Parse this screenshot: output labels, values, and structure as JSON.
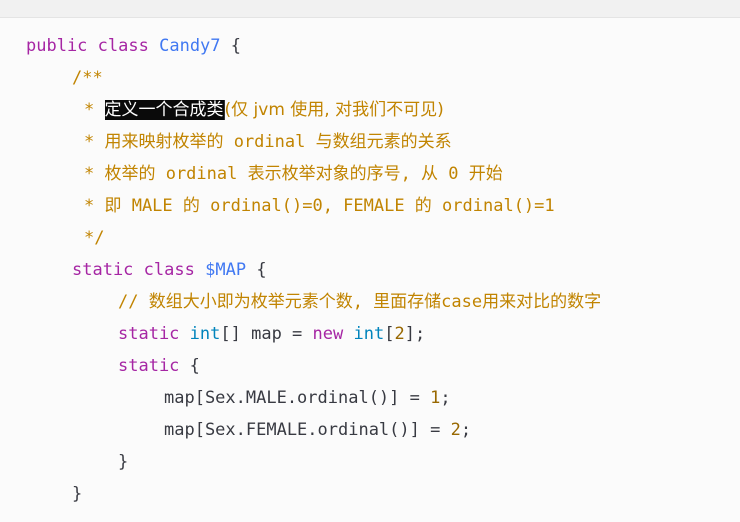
{
  "code": {
    "line1": {
      "kw1": "public",
      "kw2": "class",
      "name": "Candy7",
      "brace": "{"
    },
    "line2": {
      "text": "/**"
    },
    "line3": {
      "star": "*",
      "selected": "定义一个合成类",
      "rest": "(仅 jvm 使用, 对我们不可见)"
    },
    "line4": {
      "text": "* 用来映射枚举的 ordinal 与数组元素的关系"
    },
    "line5": {
      "text": "* 枚举的 ordinal 表示枚举对象的序号, 从 0 开始"
    },
    "line6": {
      "text": "* 即 MALE 的 ordinal()=0, FEMALE 的 ordinal()=1"
    },
    "line7": {
      "text": "*/"
    },
    "line8": {
      "kw1": "static",
      "kw2": "class",
      "name": "$MAP",
      "brace": "{"
    },
    "line9": {
      "text": "// 数组大小即为枚举元素个数, 里面存储case用来对比的数字"
    },
    "line10": {
      "kw1": "static",
      "type1": "int",
      "mid": "[] map = ",
      "kw2": "new",
      "type2": "int",
      "open": "[",
      "num": "2",
      "close": "];"
    },
    "line11": {
      "kw": "static",
      "brace": "{"
    },
    "line12": {
      "expr": "map[Sex.MALE.ordinal()] = ",
      "num": "1",
      "end": ";"
    },
    "line13": {
      "expr": "map[Sex.FEMALE.ordinal()] = ",
      "num": "2",
      "end": ";"
    },
    "line14": {
      "text": "}"
    },
    "line15": {
      "text": "}"
    }
  },
  "colors": {
    "keyword": "#a626a4",
    "class_name": "#4078f2",
    "type": "#0184bc",
    "number": "#986801",
    "comment": "#c18401",
    "selection": "#0a0a0a"
  }
}
